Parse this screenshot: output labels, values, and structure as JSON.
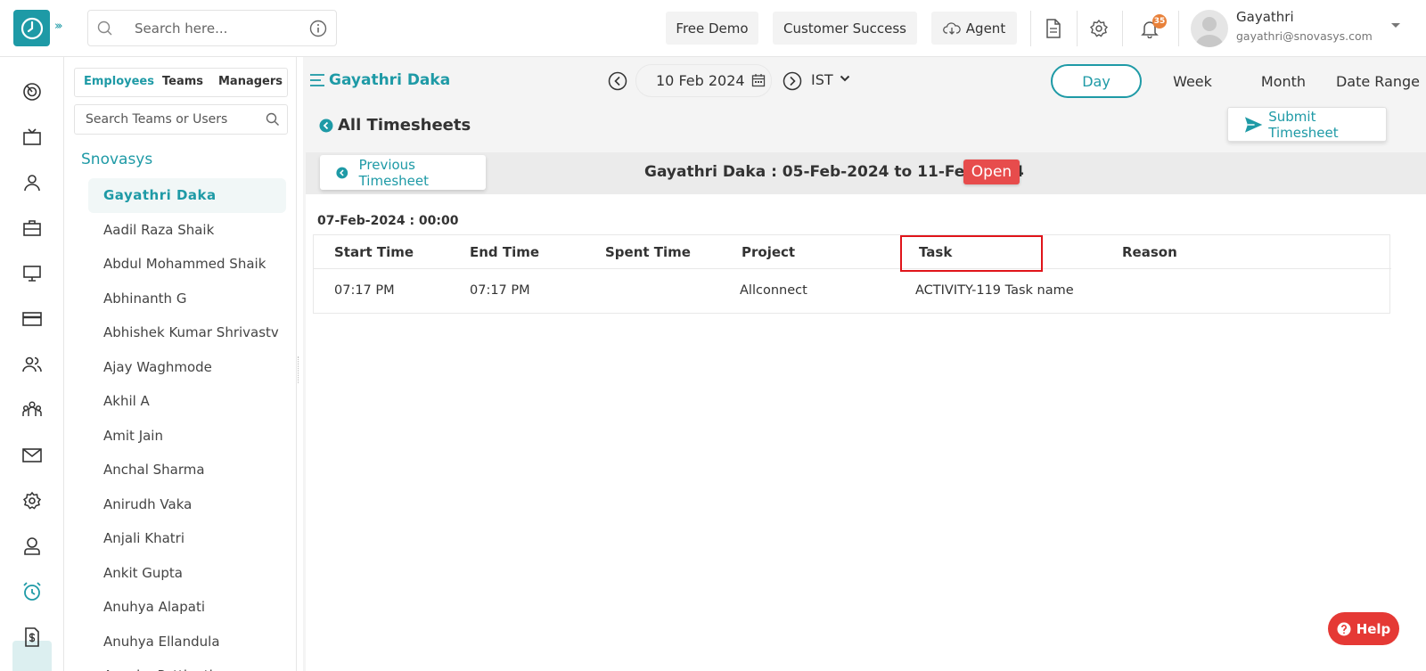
{
  "header": {
    "search_placeholder": "Search here...",
    "free_demo": "Free Demo",
    "customer_success": "Customer Success",
    "agent": "Agent",
    "notification_count": "35",
    "user_name": "Gayathri",
    "user_email": "gayathri@snovasys.com"
  },
  "sidebar": {
    "tabs": [
      "Employees",
      "Teams",
      "Managers"
    ],
    "search_placeholder": "Search Teams or Users",
    "org": "Snovasys",
    "users": [
      "Gayathri Daka",
      "Aadil Raza Shaik",
      "Abdul Mohammed Shaik",
      "Abhinanth G",
      "Abhishek Kumar Shrivastv",
      "Ajay Waghmode",
      "Akhil A",
      "Amit Jain",
      "Anchal Sharma",
      "Anirudh Vaka",
      "Anjali Khatri",
      "Ankit Gupta",
      "Anuhya Alapati",
      "Anuhya Ellandula",
      "Anusha Pattipati"
    ]
  },
  "main": {
    "employee": "Gayathri Daka",
    "date": "10 Feb 2024",
    "timezone": "IST",
    "periods": [
      "Day",
      "Week",
      "Month",
      "Date Range"
    ],
    "all_timesheets": "All Timesheets",
    "submit": "Submit Timesheet",
    "previous": "Previous Timesheet",
    "range_title": "Gayathri Daka : 05-Feb-2024 to 11-Feb-2024",
    "status": "Open",
    "day_label": "07-Feb-2024 : 00:00",
    "columns": [
      "Start Time",
      "End Time",
      "Spent Time",
      "Project",
      "Task",
      "Reason"
    ],
    "row": [
      "07:17 PM",
      "07:17 PM",
      "",
      "Allconnect",
      "ACTIVITY-119 Task name",
      ""
    ]
  },
  "help": "Help",
  "colors": {
    "accent": "#1e9aa6",
    "status_open": "#e74c4c",
    "highlight": "#e0141a"
  }
}
